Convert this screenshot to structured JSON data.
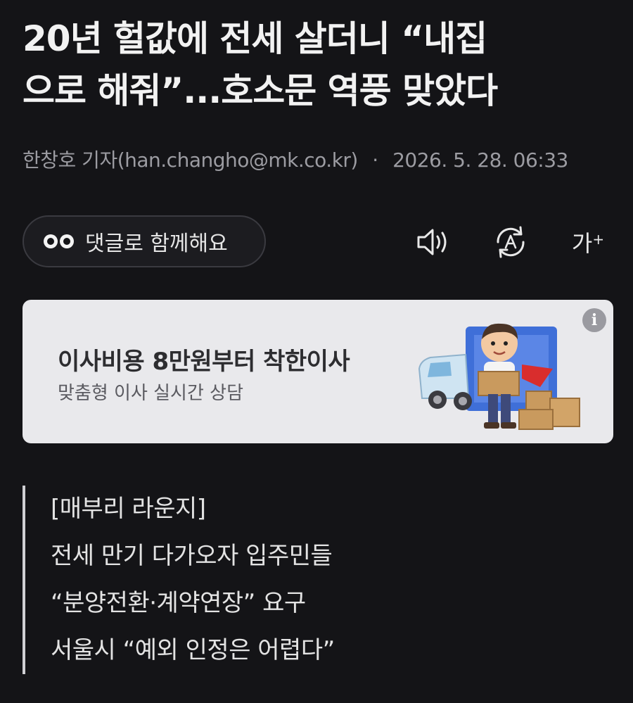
{
  "article": {
    "headline_line1": "20년 헐값에 전세 살더니 “내집",
    "headline_line2": "으로 해줘”...호소문 역풍 맞았다",
    "byline_author": "한창호 기자(han.changho@mk.co.kr)",
    "byline_separator": "·",
    "byline_date": "2026. 5. 28. 06:33"
  },
  "toolbar": {
    "comment_label": "댓글로 함께해요",
    "font_size_label": "가",
    "font_size_plus": "+",
    "icons": [
      "eyes-icon",
      "speaker-icon",
      "auto-translate-icon",
      "font-size-icon"
    ]
  },
  "ad": {
    "title": "이사비용 8만원부터 착한이사",
    "subtitle": "맞춤형 이사 실시간 상담",
    "info_label": "i"
  },
  "summary": {
    "lines": [
      "[매부리 라운지]",
      "전세 만기 다가오자 입주민들",
      "“분양전환·계약연장” 요구",
      "서울시 “예외 인정은 어렵다”"
    ]
  },
  "colors": {
    "background": "#141417",
    "ad_background": "#e9e9ec",
    "text_primary": "#f2f2f2",
    "text_muted": "#9c9ca2"
  }
}
